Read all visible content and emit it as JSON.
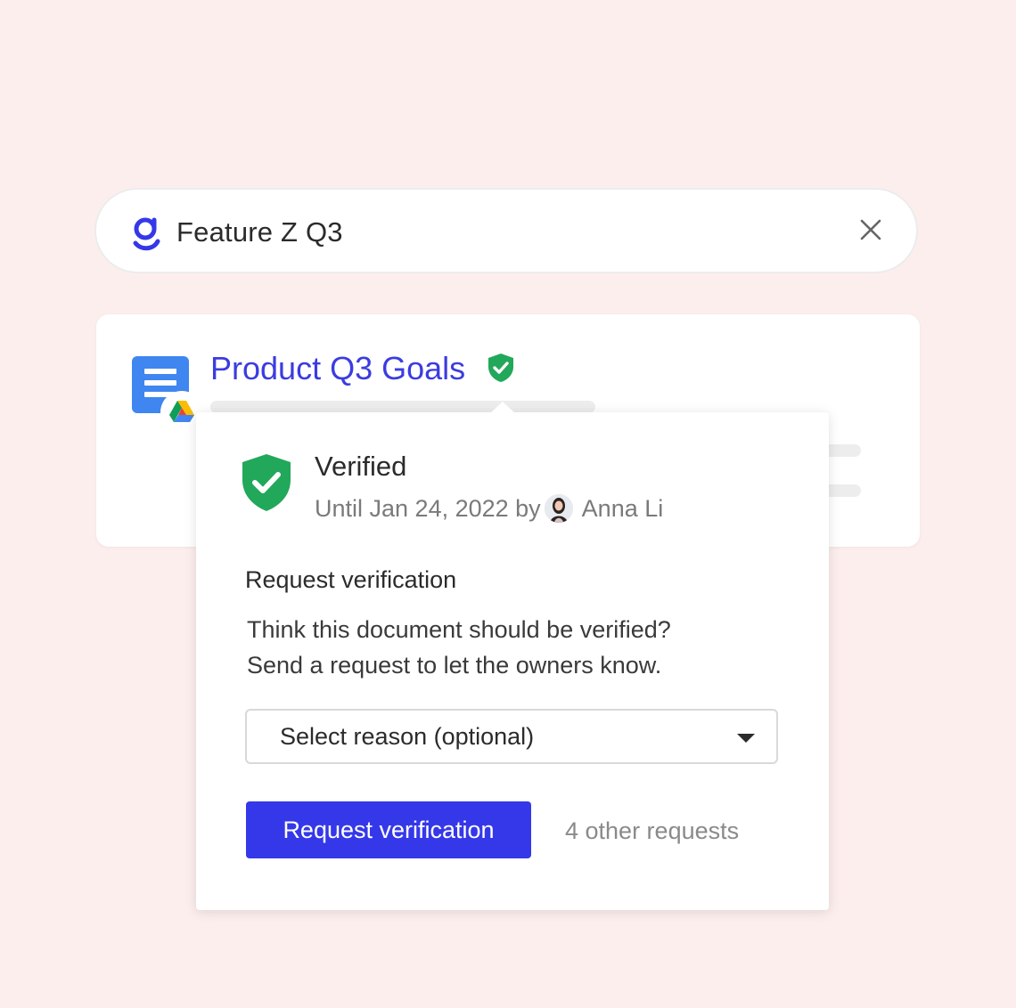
{
  "search": {
    "query": "Feature Z Q3",
    "logo_icon": "glean-logo-icon",
    "clear_icon": "close-icon"
  },
  "result": {
    "title": "Product Q3 Goals",
    "doc_icon": "google-docs-icon",
    "source_icon": "google-drive-icon",
    "verified_icon": "shield-check-icon"
  },
  "popover": {
    "status": "Verified",
    "until_text": "Until Jan 24, 2022 by",
    "verifier_name": "Anna Li",
    "section_title": "Request verification",
    "body_line_1": "Think this document should be verified?",
    "body_line_2": "Send a request to let the owners know.",
    "select_placeholder": "Select reason (optional)",
    "button_label": "Request verification",
    "other_requests": "4 other requests"
  },
  "colors": {
    "background": "#fdeeee",
    "accent": "#3538e8",
    "link": "#3b3ce0",
    "verified_green": "#22a85a",
    "doc_blue": "#3f86f0"
  }
}
